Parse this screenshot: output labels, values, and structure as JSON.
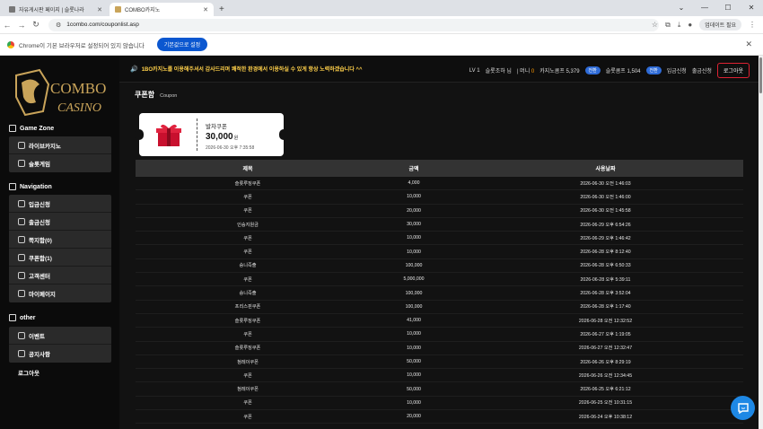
{
  "browser": {
    "tabs": [
      {
        "label": "자유게시판 페이지 | 슬롯나라",
        "active": false
      },
      {
        "label": "COMBO카지노",
        "active": true
      }
    ],
    "url": "1combo.com/couponlist.asp",
    "update_label": "업데이트 필요",
    "infobar_text": "Chrome이 기본 브라우저로 설정되어 있지 않습니다",
    "infobar_button": "기본값으로 설정"
  },
  "sidebar": {
    "logo_top": "COMBO",
    "logo_bottom": "CASINO",
    "sections": [
      {
        "title": "Game Zone",
        "items": [
          "라이브카지노",
          "슬롯게임"
        ]
      },
      {
        "title": "Navigation",
        "items": [
          "입금신청",
          "출금신청",
          "쪽지함(0)",
          "쿠폰함(1)",
          "고객센터",
          "마이페이지"
        ]
      },
      {
        "title": "other",
        "items": [
          "이벤트",
          "공지사항"
        ]
      }
    ],
    "logout": "로그아웃"
  },
  "header": {
    "notice": "1BO카지노를 이용해주셔서 감사드리며 쾌적한 환경에서 이용하실 수 있게 항상 노력하겠습니다 ^^",
    "level": "LV 1",
    "user": "슬롯조하 님",
    "money_label": "머니",
    "money_value": "0",
    "casino_point_label": "카지노콤프",
    "casino_point_value": "5,379",
    "slot_point_label": "슬롯콤프",
    "slot_point_value": "1,504",
    "convert_label": "전환",
    "deposit": "입금신청",
    "withdraw": "출금신청",
    "logout": "로그아웃"
  },
  "page": {
    "title": "쿠폰함",
    "subtitle": "Coupon"
  },
  "coupon_card": {
    "title": "발차쿠폰",
    "amount": "30,000",
    "unit": "원",
    "date": "2026-06-30 오후 7:35:58"
  },
  "table": {
    "headers": [
      "제목",
      "금액",
      "사용날짜"
    ],
    "rows": [
      [
        "슬롯루징쿠폰",
        "4,000",
        "2026-06-30 오전 1:46:03"
      ],
      [
        "쿠폰",
        "10,000",
        "2026-06-30 오전 1:46:00"
      ],
      [
        "쿠폰",
        "20,000",
        "2026-06-30 오전 1:45:58"
      ],
      [
        "인승지원금",
        "30,000",
        "2026-06-29 오후 6:54:26"
      ],
      [
        "쿠폰",
        "10,000",
        "2026-06-29 오후 1:46:42"
      ],
      [
        "쿠폰",
        "10,000",
        "2026-06-28 오후 8:12:40"
      ],
      [
        "승니즉출",
        "100,000",
        "2026-06-28 오후 6:50:33"
      ],
      [
        "쿠폰",
        "5,000,000",
        "2026-06-28 오후 5:39:11"
      ],
      [
        "승니즉출",
        "100,000",
        "2026-06-28 오후 3:52:04"
      ],
      [
        "프리스핀쿠폰",
        "100,000",
        "2026-06-28 오후 1:17:40"
      ],
      [
        "슬롯루징쿠폰",
        "41,000",
        "2026-06-28 오전 12:32:52"
      ],
      [
        "쿠폰",
        "10,000",
        "2026-06-27 오후 1:19:05"
      ],
      [
        "슬롯루징쿠폰",
        "10,000",
        "2026-06-27 오전 12:32:47"
      ],
      [
        "첨레이쿠폰",
        "50,000",
        "2026-06-26 오후 8:29:19"
      ],
      [
        "쿠폰",
        "10,000",
        "2026-06-26 오전 12:34:45"
      ],
      [
        "첨레이쿠폰",
        "50,000",
        "2026-06-25 오후 6:21:12"
      ],
      [
        "쿠폰",
        "10,000",
        "2026-06-25 오전 10:31:15"
      ],
      [
        "쿠폰",
        "20,000",
        "2026-06-24 오후 10:38:12"
      ]
    ]
  },
  "colors": {
    "accent": "#ff9900",
    "notice": "#ffd04a",
    "badge": "#2e6bd7",
    "logout_border": "#dd2233",
    "logo_gold": "#c9a45a"
  }
}
